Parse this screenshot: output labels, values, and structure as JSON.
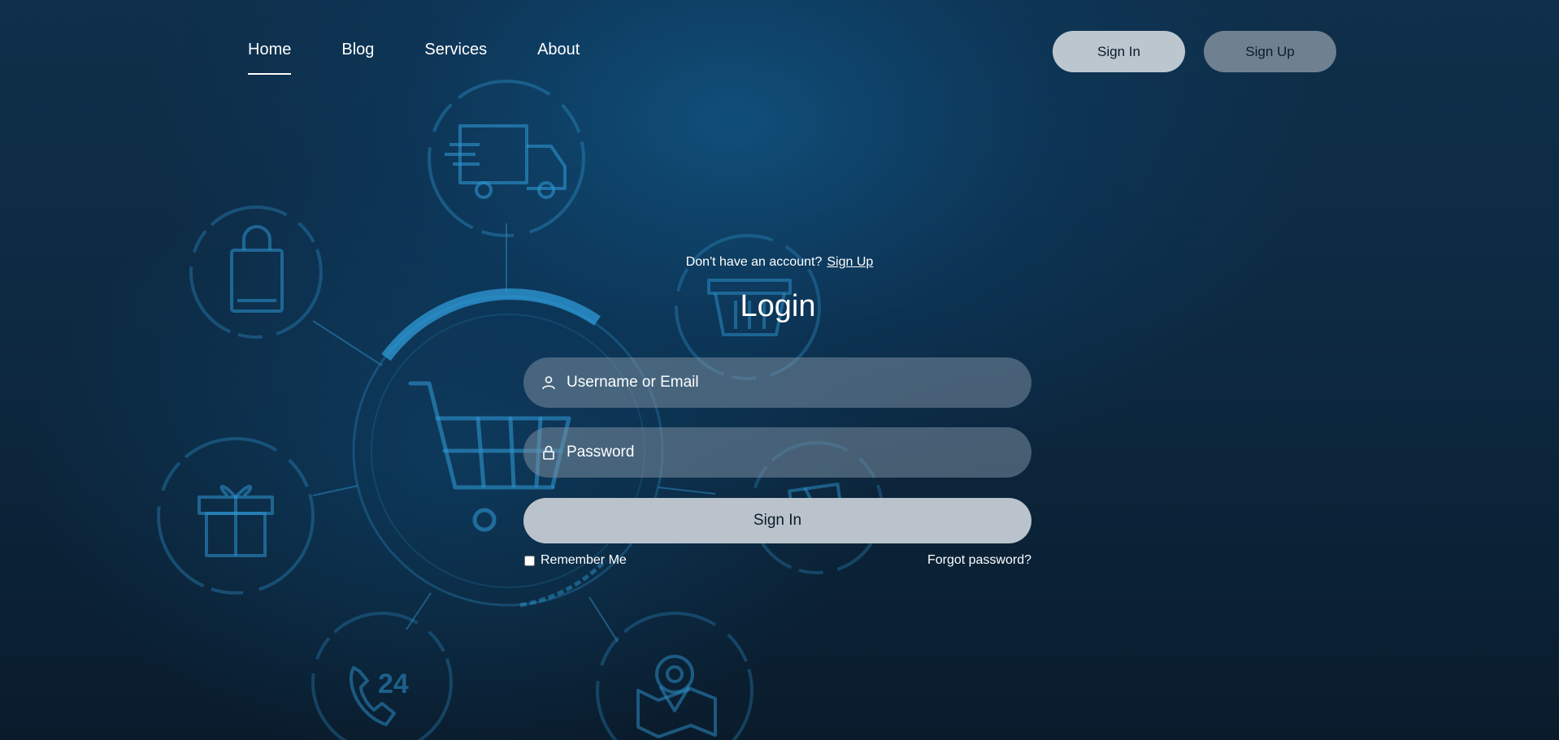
{
  "nav": {
    "links": [
      {
        "label": "Home",
        "active": true
      },
      {
        "label": "Blog",
        "active": false
      },
      {
        "label": "Services",
        "active": false
      },
      {
        "label": "About",
        "active": false
      }
    ],
    "signin_button": "Sign In",
    "signup_button": "Sign Up"
  },
  "form": {
    "prompt_text": "Don't have an account?",
    "prompt_link": "Sign Up",
    "title": "Login",
    "username_placeholder": "Username or Email",
    "password_placeholder": "Password",
    "submit_label": "Sign In",
    "remember_label": "Remember Me",
    "remember_checked": false,
    "forgot_label": "Forgot password?"
  },
  "icons": {
    "username": "user-icon",
    "password": "lock-icon"
  },
  "background_icons": [
    "truck-icon",
    "shopping-bag-icon",
    "basket-icon",
    "shopping-cart-icon",
    "gift-icon",
    "package-icon",
    "phone-24-icon",
    "map-pin-icon"
  ],
  "colors": {
    "background": "#0d2a43",
    "field": "#798d9f",
    "signin_button": "#bcc6cf",
    "signup_button": "#6f8190",
    "form_submit": "#bac3cb",
    "art": "#2d8fc4"
  }
}
